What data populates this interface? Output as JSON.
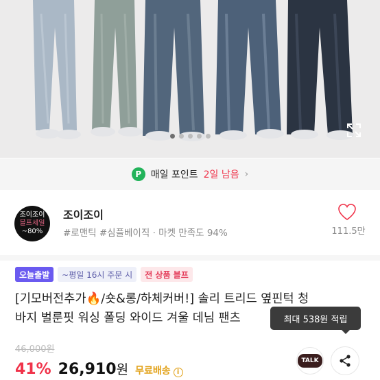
{
  "hero": {
    "image_alt": "",
    "slide_count": 5,
    "active_slide": 0
  },
  "points_bar": {
    "badge": "P",
    "label": "매일 포인트",
    "highlight": "2일 남음",
    "chevron": "›"
  },
  "shop": {
    "logo_line1": "조이조이",
    "logo_line2": "블프세일",
    "logo_line3": "~80%",
    "name": "조이조이",
    "meta": "#로맨틱 #심플베이직 · 마켓 만족도 94%",
    "likes": "111.5만"
  },
  "badges": {
    "fast": "오늘출발",
    "cutoff": "~평일 16시 주문 시",
    "sale": "전 상품 블프"
  },
  "product": {
    "title_part1": "[기모버전추가",
    "title_emoji": "🔥",
    "title_part2": "/숏&롱/하체커버!] 솔리 트리드 옆핀턱 청",
    "title_line2": "바지 벌룬핏 워싱 폴딩 와이드 겨울 데님 팬츠"
  },
  "tooltip": {
    "text": "최대 538원 적립"
  },
  "price": {
    "original": "46,000원",
    "discount": "41%",
    "sale_amount": "26,910",
    "sale_unit": "원",
    "shipping": "무료배송",
    "info": "i"
  },
  "actions": {
    "talk": "TALK"
  },
  "colors": {
    "accent_red": "#f0334a",
    "points_green": "#22b35a",
    "badge_purple": "#6a5af0",
    "shipping_gold": "#e2a21a"
  }
}
